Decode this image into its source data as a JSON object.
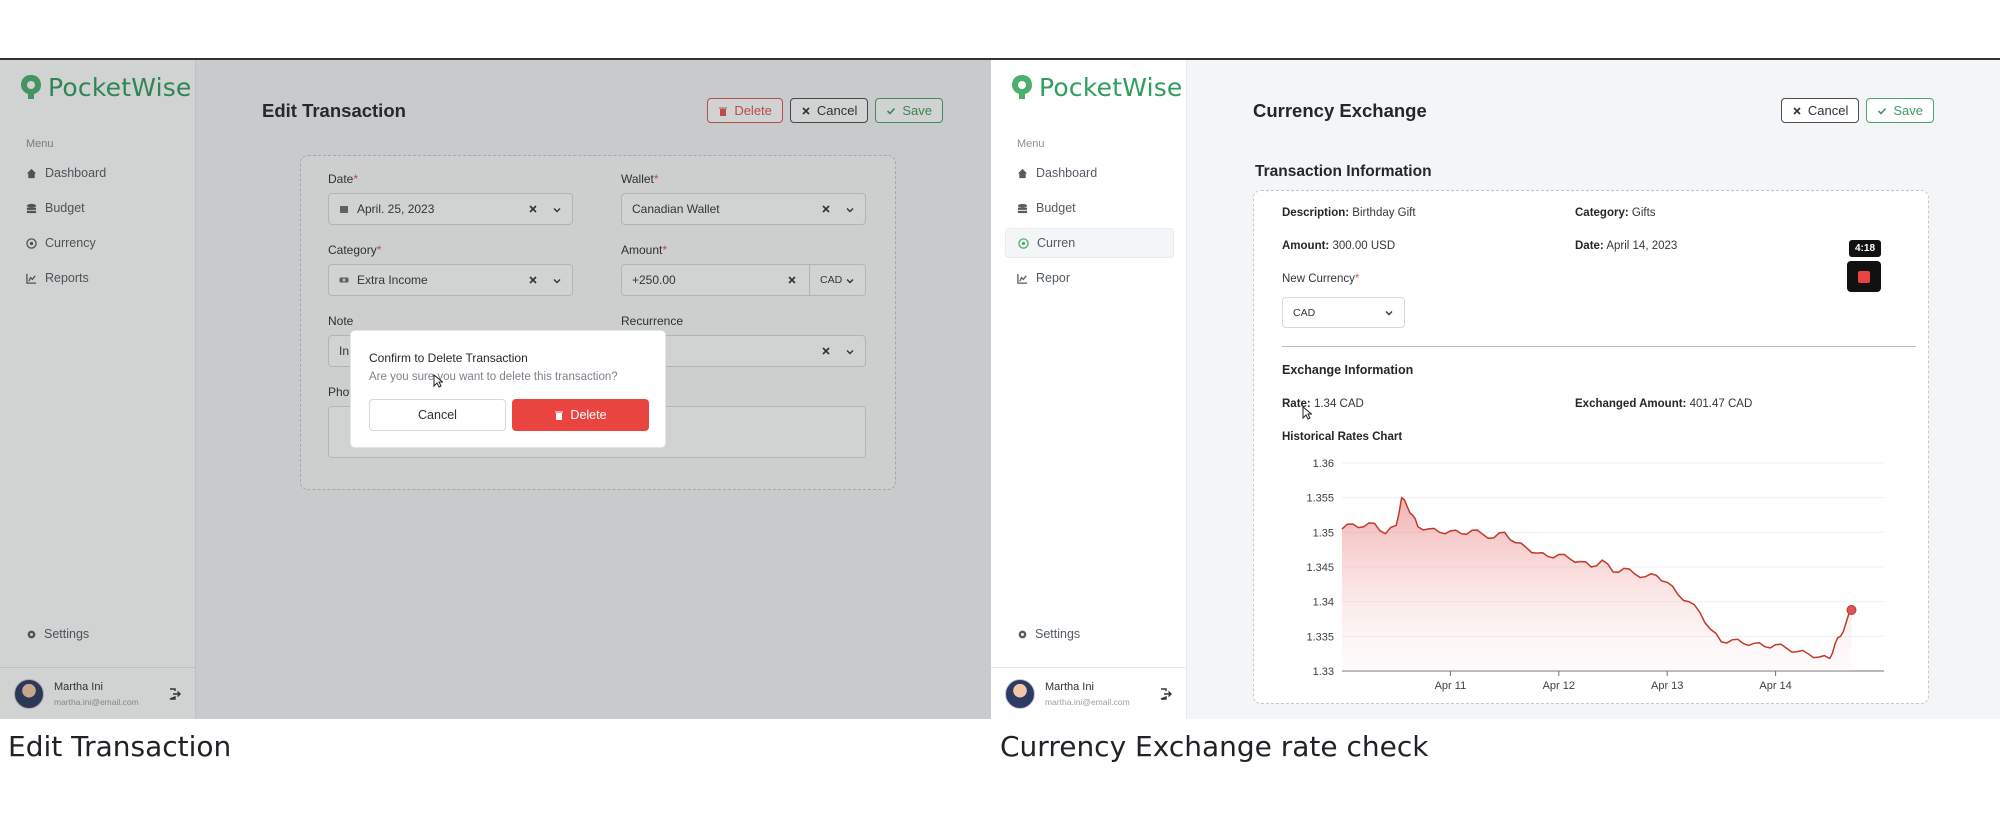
{
  "colors": {
    "brand_green": "#2f9e5c",
    "danger": "#e9443f",
    "chart_line": "#c0392b"
  },
  "left": {
    "app_name": "PocketWise",
    "menu_label": "Menu",
    "nav": [
      {
        "label": "Dashboard",
        "icon": "home-icon"
      },
      {
        "label": "Budget",
        "icon": "coins-icon"
      },
      {
        "label": "Currency",
        "icon": "currency-icon"
      },
      {
        "label": "Reports",
        "icon": "chart-icon"
      }
    ],
    "settings_label": "Settings",
    "user": {
      "name": "Martha Ini",
      "email": "martha.ini@email.com"
    },
    "page_title": "Edit Transaction",
    "actions": {
      "delete": "Delete",
      "cancel": "Cancel",
      "save": "Save"
    },
    "form": {
      "date": {
        "label": "Date",
        "value": "April. 25, 2023"
      },
      "wallet": {
        "label": "Wallet",
        "value": "Canadian Wallet"
      },
      "category": {
        "label": "Category",
        "value": "Extra Income"
      },
      "amount": {
        "label": "Amount",
        "value": "+250.00",
        "currency": "CAD"
      },
      "note": {
        "label": "Note",
        "value": "In"
      },
      "recurrence": {
        "label": "Recurrence"
      },
      "photo": {
        "label": "Phot"
      }
    },
    "dialog": {
      "title": "Confirm to Delete Transaction",
      "text": "Are you sure you want to delete this transaction?",
      "cancel": "Cancel",
      "delete": "Delete"
    }
  },
  "right": {
    "app_name": "PocketWise",
    "menu_label": "Menu",
    "nav": [
      {
        "label": "Dashboard",
        "icon": "home-icon"
      },
      {
        "label": "Budget",
        "icon": "coins-icon"
      },
      {
        "label": "Curren",
        "icon": "currency-icon"
      },
      {
        "label": "Repor",
        "icon": "chart-icon"
      }
    ],
    "settings_label": "Settings",
    "user": {
      "name": "Martha Ini",
      "email": "martha.ini@email.com"
    },
    "recording_time": "4:18",
    "page_title": "Currency Exchange",
    "actions": {
      "cancel": "Cancel",
      "save": "Save"
    },
    "transaction_info": {
      "title": "Transaction Information",
      "description_label": "Description:",
      "description": "Birthday Gift",
      "category_label": "Category:",
      "category": "Gifts",
      "amount_label": "Amount:",
      "amount": "300.00 USD",
      "date_label": "Date:",
      "date": "April 14, 2023",
      "new_currency_label": "New Currency",
      "new_currency": "CAD"
    },
    "exchange_info": {
      "title": "Exchange Information",
      "rate_label": "Rate:",
      "rate": "1.34 CAD",
      "exchanged_label": "Exchanged Amount:",
      "exchanged": "401.47 CAD",
      "chart_title": "Historical Rates Chart"
    }
  },
  "captions": {
    "left": "Edit Transaction",
    "right": "Currency Exchange rate check"
  },
  "chart_data": {
    "type": "area",
    "ylim": [
      1.33,
      1.36
    ],
    "yticks": [
      "1.36",
      "1.355",
      "1.35",
      "1.345",
      "1.34",
      "1.335",
      "1.33"
    ],
    "ytick_values": [
      1.36,
      1.355,
      1.35,
      1.345,
      1.34,
      1.335,
      1.33
    ],
    "xticks": [
      "Apr 11",
      "Apr 12",
      "Apr 13",
      "Apr 14"
    ],
    "x_start_day": 10.0,
    "x_end_day": 15.0,
    "grid": true,
    "series": [
      {
        "x": [
          10.0,
          10.1,
          10.2,
          10.3,
          10.4,
          10.5,
          10.55,
          10.6,
          10.65,
          10.7,
          10.8,
          10.9,
          11.0,
          11.1,
          11.2,
          11.3,
          11.4,
          11.5,
          11.6,
          11.7,
          11.8,
          11.9,
          12.0,
          12.1,
          12.2,
          12.3,
          12.4,
          12.5,
          12.6,
          12.7,
          12.8,
          12.9,
          13.0,
          13.1,
          13.2,
          13.3,
          13.4,
          13.5,
          13.6,
          13.7,
          13.8,
          13.9,
          14.0,
          14.1,
          14.2,
          14.3,
          14.4,
          14.5,
          14.55,
          14.6,
          14.65,
          14.7
        ],
        "y": [
          1.3505,
          1.3512,
          1.3508,
          1.3513,
          1.3498,
          1.351,
          1.355,
          1.3538,
          1.3525,
          1.3508,
          1.3505,
          1.35,
          1.3502,
          1.3498,
          1.3503,
          1.3497,
          1.3492,
          1.35,
          1.3485,
          1.3478,
          1.347,
          1.3465,
          1.3468,
          1.3462,
          1.3458,
          1.345,
          1.346,
          1.3443,
          1.3448,
          1.344,
          1.3436,
          1.3438,
          1.3428,
          1.341,
          1.34,
          1.3385,
          1.336,
          1.3342,
          1.3345,
          1.334,
          1.334,
          1.3335,
          1.3338,
          1.3333,
          1.3328,
          1.3325,
          1.332,
          1.3318,
          1.334,
          1.335,
          1.337,
          1.3388
        ]
      }
    ]
  }
}
